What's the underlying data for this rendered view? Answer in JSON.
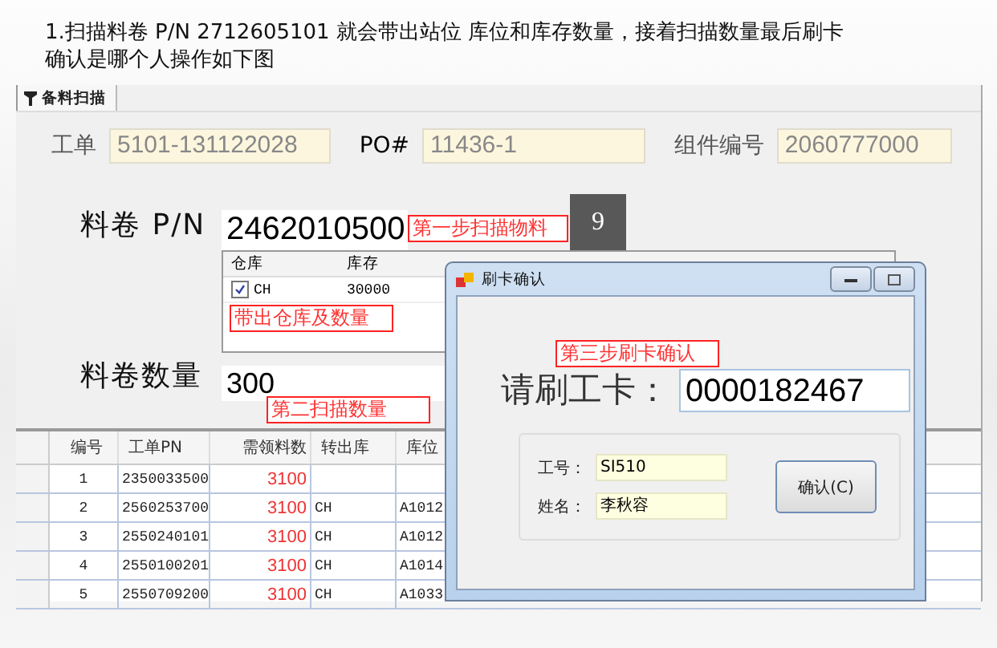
{
  "caption": {
    "lines": [
      "1.扫描料卷 P/N 2712605101 就会带出站位 库位和库存数量，接着扫描数量最后刷卡",
      "确认是哪个人操作如下图"
    ]
  },
  "tabs": [
    {
      "label": "备料扫描",
      "selected": true
    }
  ],
  "header_fields": [
    {
      "label": "工单",
      "value": "5101-131122028"
    },
    {
      "label": "PO#",
      "value": "11436-1"
    },
    {
      "label": "组件编号",
      "value": "2060777000"
    }
  ],
  "pn": {
    "label": "料卷 P/N",
    "value": "2462010500",
    "badge": "9",
    "annotation": "第一步扫描物料"
  },
  "stock_grid": {
    "columns": [
      "仓库",
      "库存"
    ],
    "rows": [
      {
        "checked": true,
        "warehouse": "CH",
        "stock": "30000"
      }
    ],
    "annotation": "带出仓库及数量"
  },
  "qty": {
    "label": "料卷数量",
    "value": "300",
    "annotation": "第二扫描数量"
  },
  "table": {
    "columns": [
      "编号",
      "工单PN",
      "需领料数",
      "转出库",
      "库位"
    ],
    "rows": [
      [
        "1",
        "2350033500",
        "3100",
        "",
        ""
      ],
      [
        "2",
        "2560253700",
        "3100",
        "CH",
        "A1012"
      ],
      [
        "3",
        "2550240101",
        "3100",
        "CH",
        "A1012"
      ],
      [
        "4",
        "2550100201",
        "3100",
        "CH",
        "A1014"
      ],
      [
        "5",
        "2550709200",
        "3100",
        "CH",
        "A1033"
      ]
    ]
  },
  "dialog": {
    "title": "刷卡确认",
    "annotation": "第三步刷卡确认",
    "prompt": "请刷工卡：",
    "card": "0000182467",
    "fields": [
      {
        "label": "工号：",
        "value": "SI510"
      },
      {
        "label": "姓名：",
        "value": "李秋容"
      }
    ],
    "button": "确认(C)"
  }
}
